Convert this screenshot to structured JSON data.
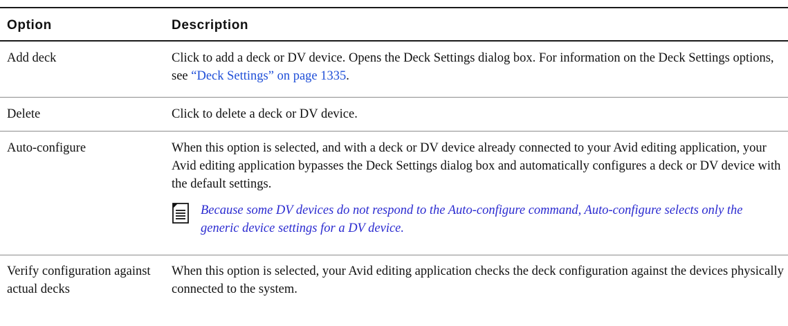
{
  "header": {
    "option": "Option",
    "description": "Description"
  },
  "rows": [
    {
      "option": "Add deck",
      "description_pre": "Click to add a deck or DV device. Opens the Deck Settings dialog box. For information on the Deck Settings options, see ",
      "link": "“Deck Settings” on page 1335",
      "description_post": "."
    },
    {
      "option": "Delete",
      "description": "Click to delete a deck or DV device."
    },
    {
      "option": "Auto-configure",
      "description": "When this option is selected, and with a deck or DV device already connected to your Avid editing application, your Avid editing application bypasses the Deck Settings dialog box and automatically configures a deck or DV device with the default settings.",
      "note_icon": "note-icon",
      "note": "Because some DV devices do not respond to the Auto-configure command, Auto-configure selects only the generic device settings for a DV device."
    },
    {
      "option": "Verify configuration against actual decks",
      "description": "When this option is selected, your Avid editing application checks the deck configuration against the devices physically connected to the system."
    }
  ]
}
